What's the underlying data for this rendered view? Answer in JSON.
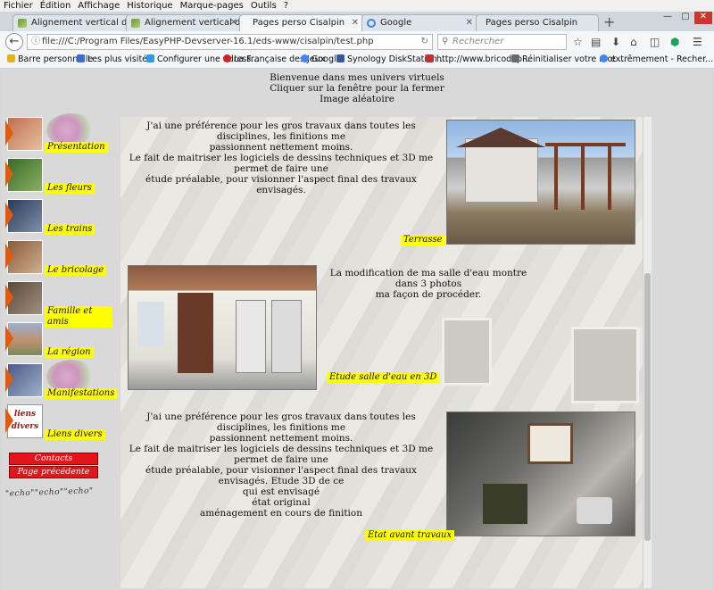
{
  "menu": [
    "Fichier",
    "Édition",
    "Affichage",
    "Historique",
    "Marque-pages",
    "Outils",
    "?"
  ],
  "tabs": [
    {
      "label": "Alignement vertical du texte"
    },
    {
      "label": "Alignement vertical du texte"
    },
    {
      "label": "Pages perso Cisalpin"
    },
    {
      "label": "Google"
    },
    {
      "label": "Pages perso Cisalpin"
    }
  ],
  "url": "file:///C:/Program Files/EasyPHP-Devserver-16.1/eds-www/cisalpin/test.php",
  "search_placeholder": "Rechercher",
  "bookmarks": [
    {
      "label": "Barre personnelle",
      "color": "#e8b020"
    },
    {
      "label": "Les plus visités",
      "color": "#3a6fd0"
    },
    {
      "label": "Configurer une adress...",
      "color": "#2f9be0"
    },
    {
      "label": "La Française des Jeux",
      "color": "#d02020"
    },
    {
      "label": "Google",
      "color": "#4285f4"
    },
    {
      "label": "Synology DiskStation ...",
      "color": "#3557a8"
    },
    {
      "label": "http://www.bricodep...",
      "color": "#c03030"
    },
    {
      "label": "Réinitialiser votre mot ...",
      "color": "#6a6a6a"
    },
    {
      "label": "extrêmement - Recher...",
      "color": "#4285f4"
    }
  ],
  "header": {
    "line1": "Bienvenue dans mes univers virtuels",
    "line2": "Cliquer sur la fenêtre pour la fermer",
    "line3": "Image aléatoire"
  },
  "sidebar": [
    {
      "label": "Présentation",
      "color": "#b06040"
    },
    {
      "label": "Les fleurs",
      "color": "#5a8a3a"
    },
    {
      "label": "Les trains",
      "color": "#4a5a7a"
    },
    {
      "label": "Le bricolage",
      "color": "#a07050"
    },
    {
      "label": "Famille et amis",
      "color": "#7a6a5a"
    },
    {
      "label": "La région",
      "color": "#b08060"
    },
    {
      "label": "Manifestations",
      "color": "#6a7a9a"
    },
    {
      "label": "Liens divers",
      "color": "#ffffff"
    }
  ],
  "liens_logo": [
    "liens",
    "divers"
  ],
  "buttons": {
    "contacts": "Contacts",
    "previous": "Page précédente"
  },
  "echo_text": "\"echo\"\"echo\"\"echo\"",
  "sections": [
    {
      "lines": [
        "J'ai une préférence pour les gros travaux dans toutes les disciplines, les finitions me",
        "passionnent nettement moins.",
        "Le fait de maitriser les logiciels de dessins techniques et 3D me permet de faire une",
        "étude préalable, pour visionner l'aspect final des travaux envisagés."
      ],
      "caption": "Terrasse"
    },
    {
      "lines": [
        "La modification de ma salle d'eau montre dans 3 photos",
        "ma façon de procéder."
      ],
      "caption": "Etude salle d'eau en 3D"
    },
    {
      "lines": [
        "J'ai une préférence pour les gros travaux dans toutes les disciplines, les finitions me",
        "passionnent nettement moins.",
        "Le fait de maitriser les logiciels de dessins techniques et 3D me permet de faire une",
        "étude préalable, pour visionner l'aspect final des travaux envisagés. Etude 3D de ce",
        "qui est envisagé",
        "état original",
        "aménagement en cours de finition"
      ],
      "caption": "Etat avant travaux"
    }
  ]
}
